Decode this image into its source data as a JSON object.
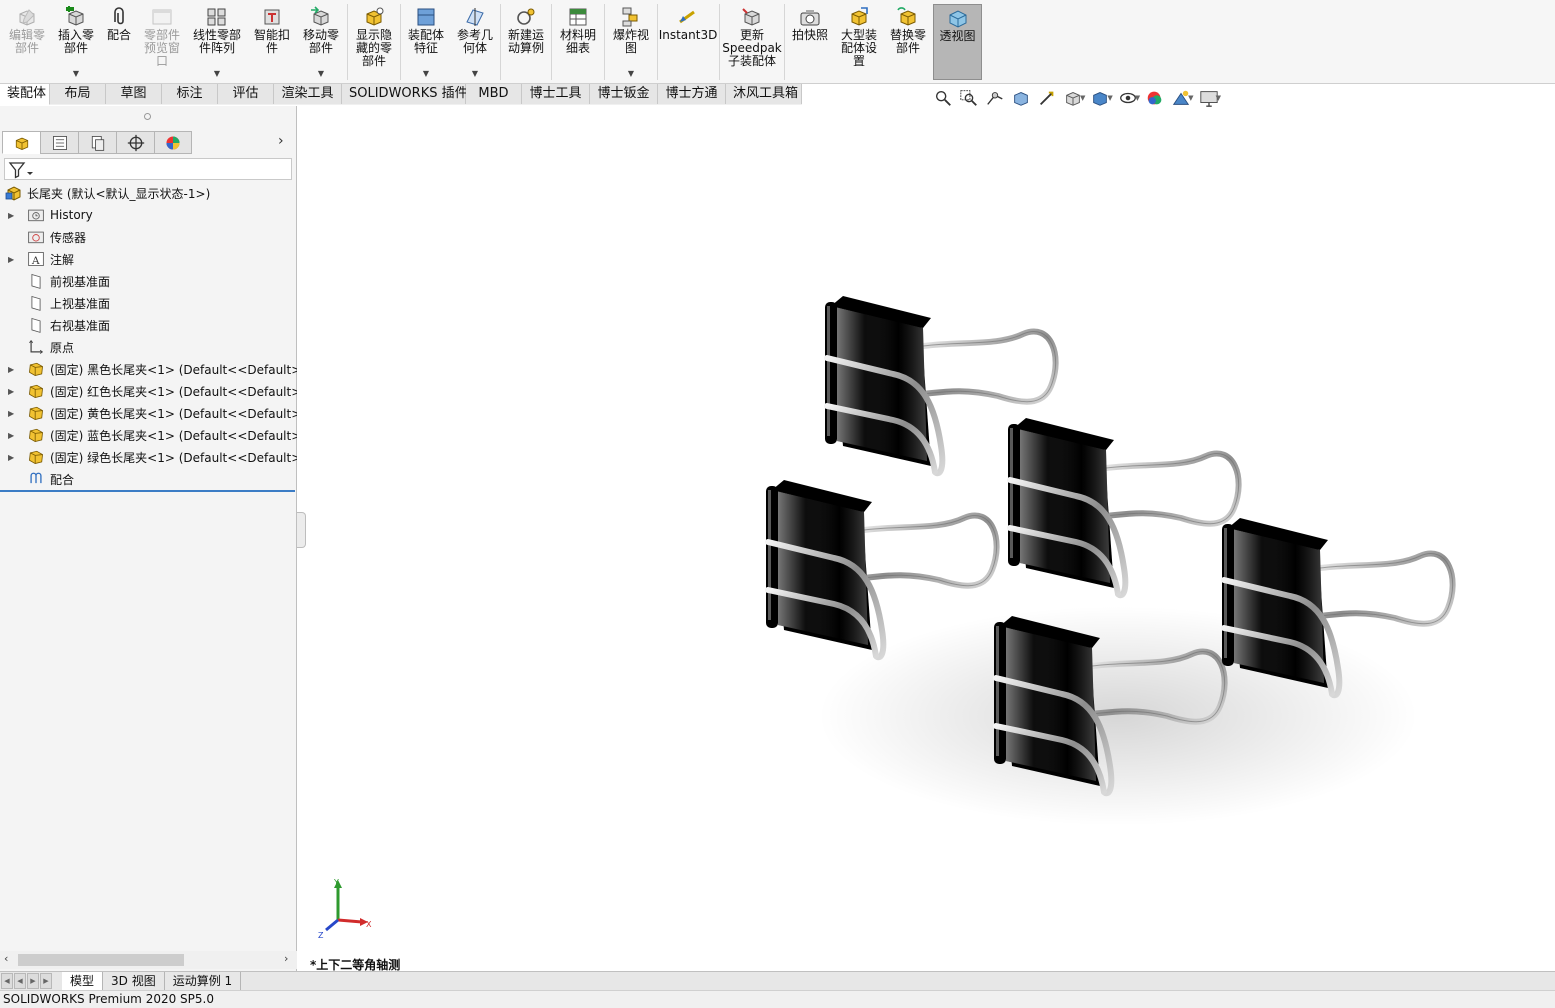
{
  "ribbon": {
    "buttons": [
      {
        "id": "edit-component",
        "label": "编辑零\n部件",
        "disabled": true,
        "arrow": false,
        "icon": "edit-component-icon"
      },
      {
        "id": "insert-components",
        "label": "插入零\n部件",
        "disabled": false,
        "arrow": true,
        "icon": "insert-component-icon"
      },
      {
        "id": "mate",
        "label": "配合",
        "disabled": false,
        "arrow": false,
        "icon": "mate-paperclip-icon"
      },
      {
        "id": "component-preview",
        "label": "零部件\n预览窗\n口",
        "disabled": true,
        "arrow": false,
        "icon": "preview-window-icon"
      },
      {
        "id": "linear-pattern",
        "label": "线性零部\n件阵列",
        "disabled": false,
        "arrow": true,
        "icon": "linear-pattern-icon"
      },
      {
        "id": "smart-fasteners",
        "label": "智能扣\n件",
        "disabled": false,
        "arrow": false,
        "icon": "smart-fastener-icon"
      },
      {
        "id": "move-component",
        "label": "移动零\n部件",
        "disabled": false,
        "arrow": true,
        "icon": "move-component-icon"
      },
      {
        "id": "show-hidden",
        "label": "显示隐\n藏的零\n部件",
        "disabled": false,
        "arrow": false,
        "icon": "show-hidden-icon"
      },
      {
        "id": "assembly-features",
        "label": "装配体\n特征",
        "disabled": false,
        "arrow": true,
        "icon": "assembly-feature-icon"
      },
      {
        "id": "reference-geometry",
        "label": "参考几\n何体",
        "disabled": false,
        "arrow": true,
        "icon": "reference-geometry-icon"
      },
      {
        "id": "new-motion-study",
        "label": "新建运\n动算例",
        "disabled": false,
        "arrow": false,
        "icon": "motion-study-icon"
      },
      {
        "id": "bill-of-materials",
        "label": "材料明\n细表",
        "disabled": false,
        "arrow": false,
        "icon": "bom-table-icon"
      },
      {
        "id": "exploded-view",
        "label": "爆炸视\n图",
        "disabled": false,
        "arrow": true,
        "icon": "exploded-view-icon"
      },
      {
        "id": "instant3d",
        "label": "Instant3D",
        "disabled": false,
        "arrow": false,
        "icon": "instant3d-icon"
      },
      {
        "id": "update-speedpak",
        "label": "更新\nSpeedpak\n子装配体",
        "disabled": false,
        "arrow": false,
        "icon": "speedpak-icon"
      },
      {
        "id": "take-snapshot",
        "label": "拍快照",
        "disabled": false,
        "arrow": false,
        "icon": "camera-icon"
      },
      {
        "id": "large-assembly",
        "label": "大型装\n配体设\n置",
        "disabled": false,
        "arrow": false,
        "icon": "large-assembly-icon"
      },
      {
        "id": "replace-components",
        "label": "替换零\n部件",
        "disabled": false,
        "arrow": false,
        "icon": "replace-component-icon"
      },
      {
        "id": "transparent-view",
        "label": "透视图",
        "disabled": false,
        "arrow": false,
        "active": true,
        "icon": "transparent-view-icon"
      }
    ]
  },
  "command_tabs": [
    {
      "label": "装配体",
      "active": true
    },
    {
      "label": "布局"
    },
    {
      "label": "草图"
    },
    {
      "label": "标注"
    },
    {
      "label": "评估"
    },
    {
      "label": "渲染工具"
    },
    {
      "label": "SOLIDWORKS 插件"
    },
    {
      "label": "MBD"
    },
    {
      "label": "博士工具"
    },
    {
      "label": "博士钣金"
    },
    {
      "label": "博士方通"
    },
    {
      "label": "沐风工具箱"
    }
  ],
  "hud_icons": [
    "zoom-to-fit-icon",
    "zoom-area-icon",
    "previous-view-icon",
    "section-view-icon",
    "dynamic-annotation-icon",
    "view-orientation-icon",
    "display-style-icon",
    "hide-show-icon",
    "edit-appearance-icon",
    "apply-scene-icon",
    "view-settings-icon"
  ],
  "feature_tree": {
    "root": "长尾夹 (默认<默认_显示状态-1>)",
    "items": [
      {
        "label": "History",
        "expand": true,
        "icon": "history-folder-icon",
        "indent": 1
      },
      {
        "label": "传感器",
        "expand": false,
        "icon": "sensor-folder-icon",
        "indent": 1
      },
      {
        "label": "注解",
        "expand": true,
        "icon": "annotation-icon",
        "indent": 1
      },
      {
        "label": "前视基准面",
        "expand": false,
        "icon": "plane-icon",
        "indent": 1
      },
      {
        "label": "上视基准面",
        "expand": false,
        "icon": "plane-icon",
        "indent": 1
      },
      {
        "label": "右视基准面",
        "expand": false,
        "icon": "plane-icon",
        "indent": 1
      },
      {
        "label": "原点",
        "expand": false,
        "icon": "origin-icon",
        "indent": 1
      },
      {
        "label": "(固定) 黑色长尾夹<1> (Default<<Default>_D",
        "expand": true,
        "icon": "part-component-icon",
        "indent": 1
      },
      {
        "label": "(固定) 红色长尾夹<1> (Default<<Default>_D",
        "expand": true,
        "icon": "part-component-icon",
        "indent": 1
      },
      {
        "label": "(固定) 黄色长尾夹<1> (Default<<Default>_D",
        "expand": true,
        "icon": "part-component-icon",
        "indent": 1
      },
      {
        "label": "(固定) 蓝色长尾夹<1> (Default<<Default>_D",
        "expand": true,
        "icon": "part-component-icon",
        "indent": 1
      },
      {
        "label": "(固定) 绿色长尾夹<1> (Default<<Default>_D",
        "expand": true,
        "icon": "part-component-icon",
        "indent": 1
      },
      {
        "label": "配合",
        "expand": false,
        "icon": "mates-folder-icon",
        "indent": 1
      }
    ]
  },
  "panel_tabs": [
    "feature-manager-icon",
    "property-manager-icon",
    "configuration-manager-icon",
    "dimxpert-icon",
    "display-manager-icon"
  ],
  "graphics": {
    "view_name": "*上下二等角轴测",
    "triad": {
      "x": "X",
      "y": "Y",
      "z": "Z"
    },
    "clips": [
      {
        "name": "red",
        "color": "#b84a4a"
      },
      {
        "name": "black",
        "color": "#2c2c2c"
      },
      {
        "name": "yellow",
        "color": "#cbc05a"
      },
      {
        "name": "blue",
        "color": "#2f52a6"
      },
      {
        "name": "green",
        "color": "#6f9e68"
      }
    ]
  },
  "bottom_tabs": [
    {
      "label": "模型",
      "active": true
    },
    {
      "label": "3D 视图"
    },
    {
      "label": "运动算例 1"
    }
  ],
  "status": "SOLIDWORKS Premium 2020 SP5.0"
}
